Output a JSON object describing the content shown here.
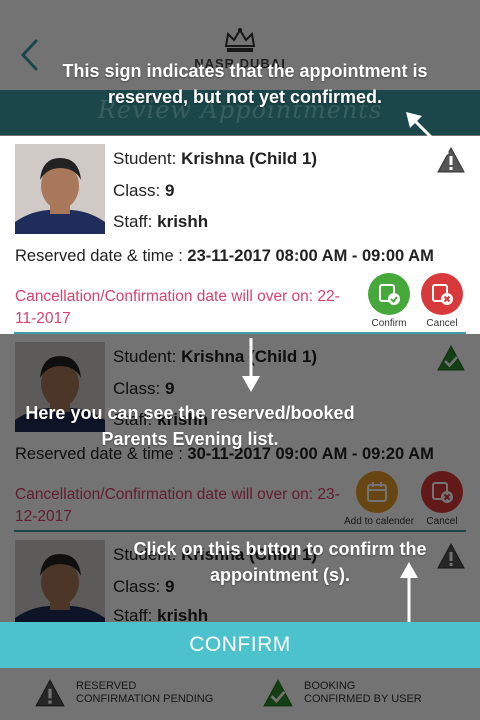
{
  "header": {
    "brand": "NASR DUBAI",
    "back_icon": "chevron-left-icon",
    "crest_icon": "crown-crest-icon"
  },
  "subheader": {
    "title": "Review Appointments"
  },
  "appointments": [
    {
      "student_label": "Student:",
      "student_name": "Krishna (Child 1)",
      "class_label": "Class:",
      "class_value": "9",
      "staff_label": "Staff:",
      "staff_value": "krishh",
      "datetime_label": "Reserved date & time :",
      "datetime_value": "23-11-2017 08:00 AM - 09:00 AM",
      "cancel_text": "Cancellation/Confirmation date will over on: 22-11-2017",
      "status": "reserved-warning-icon",
      "actions": [
        "Confirm",
        "Cancel"
      ]
    },
    {
      "student_label": "Student:",
      "student_name": "Krishna (Child 1)",
      "class_label": "Class:",
      "class_value": "9",
      "staff_label": "Staff:",
      "staff_value": "krishh",
      "datetime_label": "Reserved date & time :",
      "datetime_value": "30-11-2017 09:00 AM - 09:20 AM",
      "cancel_text": "Cancellation/Confirmation date will over on: 23-12-2017",
      "status": "booked-check-icon",
      "actions": [
        "Add to calender",
        "Cancel"
      ]
    },
    {
      "student_label": "Student:",
      "student_name": "Krishna (Child 1)",
      "class_label": "Class:",
      "class_value": "9",
      "staff_label": "Staff:",
      "staff_value": "krishh",
      "status": "reserved-warning-icon"
    }
  ],
  "confirm_button": "CONFIRM",
  "legend": {
    "reserved_line1": "RESERVED",
    "reserved_line2": "CONFIRMATION PENDING",
    "booked_line1": "BOOKING",
    "booked_line2": "CONFIRMED BY USER"
  },
  "tooltips": {
    "sign_tip": "This sign indicates that the appointment is reserved, but not yet confirmed.",
    "list_tip": "Here you can see the reserved/booked Parents Evening list.",
    "confirm_tip": "Click on this button to confirm the appointment (s)."
  },
  "colors": {
    "teal": "#3f9ea4",
    "confirm_teal": "#4cc3cc",
    "pink": "#d9426a",
    "confirm_green": "#46a83a",
    "cancel_red": "#d8393b",
    "calendar_orange": "#e69b2b"
  }
}
